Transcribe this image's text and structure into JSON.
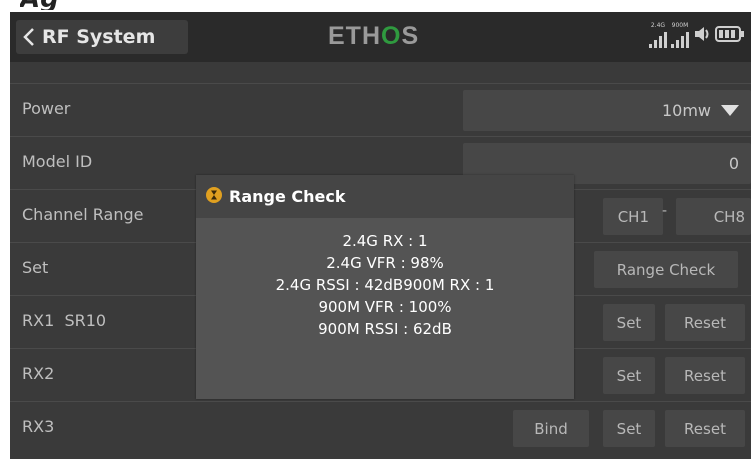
{
  "header": {
    "title": "RF System",
    "logo_left": "ETH",
    "logo_o": "O",
    "logo_right": "S",
    "signal_2g4_label": "2.4G",
    "signal_900m_label": "900M",
    "icons": [
      "chevron-left-icon",
      "signal-2g4-icon",
      "signal-900m-icon",
      "volume-icon",
      "battery-icon"
    ]
  },
  "rows": {
    "power": {
      "label": "Power",
      "value": "10mw"
    },
    "model_id": {
      "label": "Model ID",
      "value": "0"
    },
    "channel_range": {
      "label": "Channel Range",
      "start": "CH1",
      "separator": "-",
      "end": "CH8"
    },
    "set": {
      "label": "Set",
      "range_check_button": "Range Check"
    },
    "rx1": {
      "label": "RX1",
      "receiver": "SR10",
      "set_button": "Set",
      "reset_button": "Reset"
    },
    "rx2": {
      "label": "RX2",
      "set_button": "Set",
      "reset_button": "Reset"
    },
    "rx3": {
      "label": "RX3",
      "bind_button": "Bind",
      "set_button": "Set",
      "reset_button": "Reset"
    }
  },
  "dialog": {
    "title": "Range Check",
    "lines": [
      "2.4G RX : 1",
      "2.4G VFR : 98%",
      "2.4G RSSI  : 42dB900M RX : 1",
      "900M VFR : 100%",
      "900M RSSI  : 62dB"
    ]
  },
  "colors": {
    "accent": "#e0a020",
    "logo_green": "#2f9a3f",
    "background": "#3a3a3a"
  }
}
